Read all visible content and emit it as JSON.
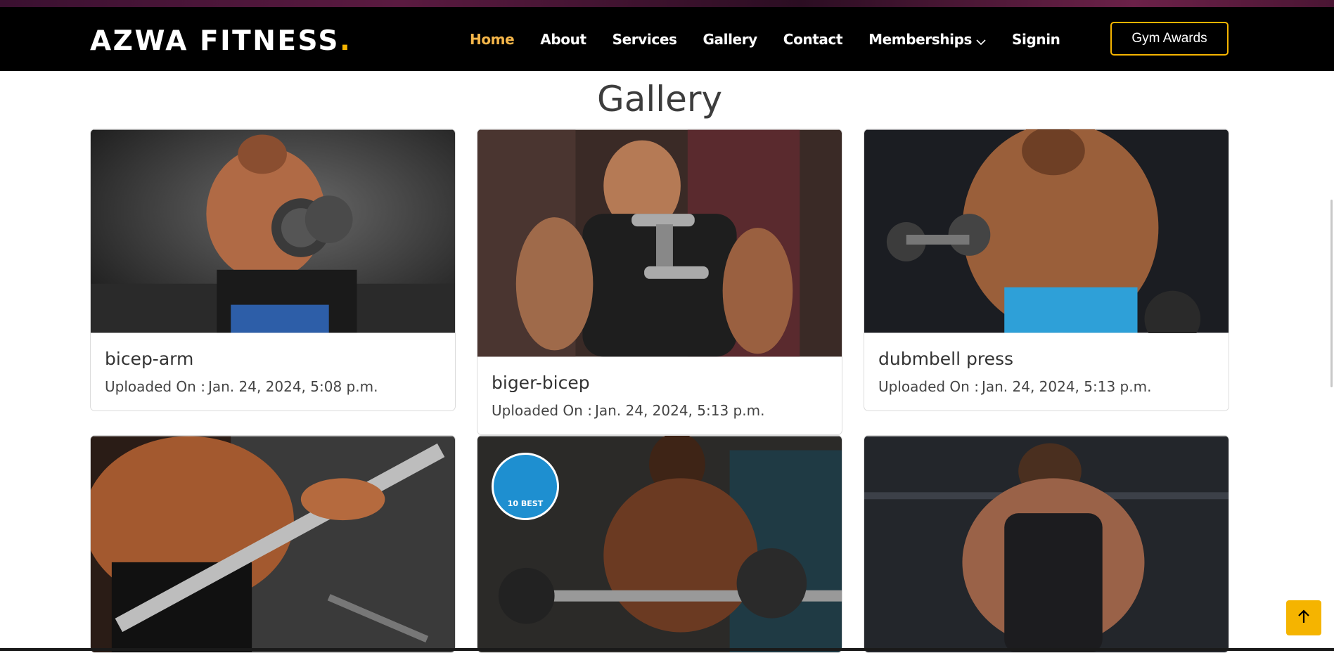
{
  "brand": {
    "name": "AZWA FITNESS",
    "dot": "."
  },
  "nav": {
    "items": [
      {
        "label": "Home",
        "active": true
      },
      {
        "label": "About",
        "active": false
      },
      {
        "label": "Services",
        "active": false
      },
      {
        "label": "Gallery",
        "active": false
      },
      {
        "label": "Contact",
        "active": false
      },
      {
        "label": "Memberships",
        "active": false,
        "dropdown": true
      },
      {
        "label": "Signin",
        "active": false
      }
    ],
    "cta_label": "Gym Awards"
  },
  "page": {
    "title": "Gallery"
  },
  "gallery": {
    "uploaded_label": "Uploaded On :",
    "items": [
      {
        "title": "bicep-arm",
        "uploaded": "Jan. 24, 2024, 5:08 p.m."
      },
      {
        "title": "biger-bicep",
        "uploaded": "Jan. 24, 2024, 5:13 p.m."
      },
      {
        "title": "dubmbell press",
        "uploaded": "Jan. 24, 2024, 5:13 p.m."
      },
      {
        "title": "",
        "uploaded": ""
      },
      {
        "title": "",
        "uploaded": "",
        "badge": "10 BEST"
      },
      {
        "title": "",
        "uploaded": ""
      }
    ]
  },
  "colors": {
    "accent": "#f5b400",
    "nav_bg": "#000000",
    "active": "#f5b64a"
  },
  "icons": {
    "back_to_top": "arrow-up-icon",
    "dropdown": "chevron-down-icon"
  }
}
